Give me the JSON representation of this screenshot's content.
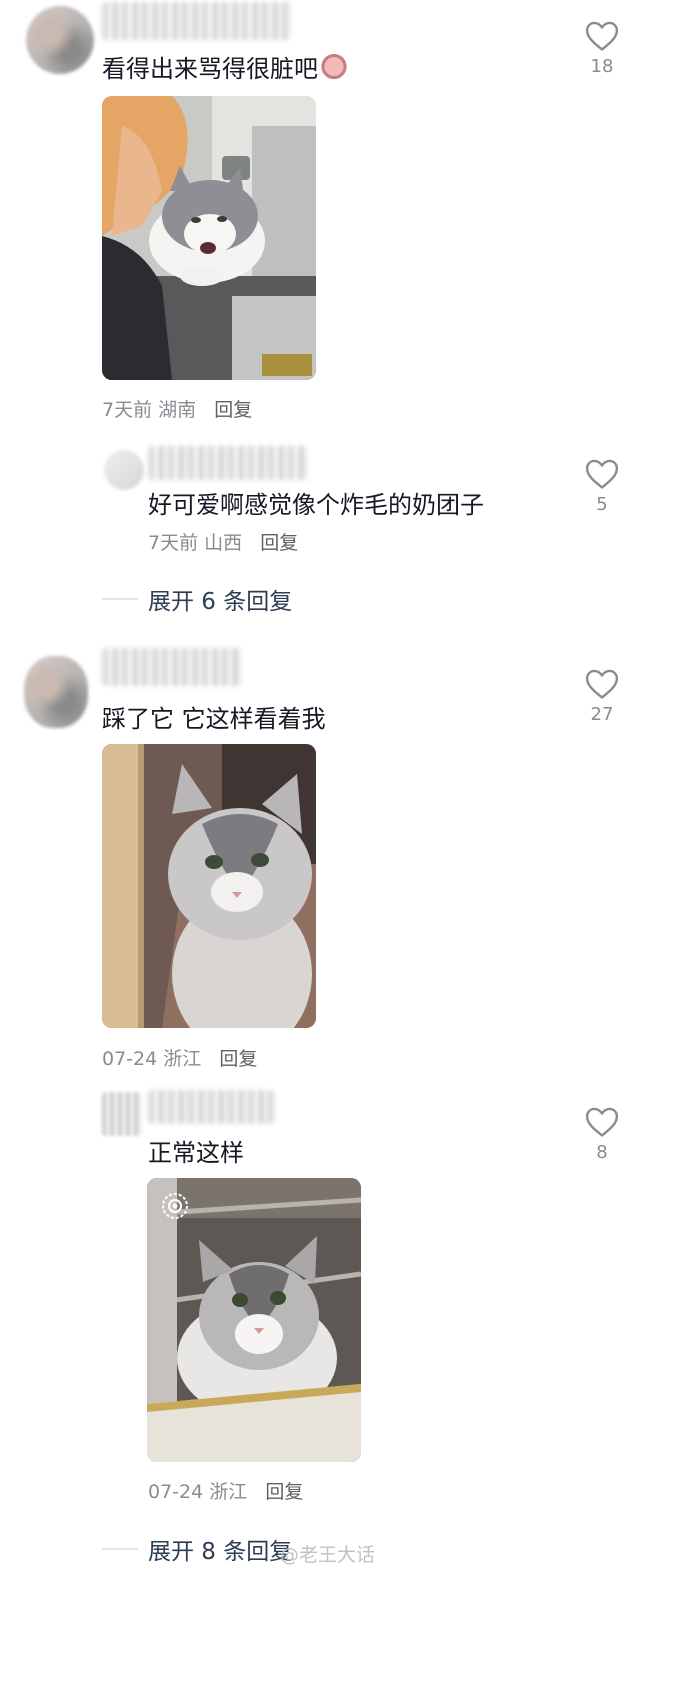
{
  "comments": [
    {
      "text": "看得出来骂得很脏吧",
      "time": "7天前",
      "location": "湖南",
      "reply_label": "回复",
      "likes": "18",
      "reply": {
        "text": "好可爱啊感觉像个炸毛的奶团子",
        "time": "7天前",
        "location": "山西",
        "reply_label": "回复",
        "likes": "5"
      },
      "expand_label": "展开 6 条回复"
    },
    {
      "text": "踩了它 它这样看着我",
      "time": "07-24",
      "location": "浙江",
      "reply_label": "回复",
      "likes": "27",
      "reply": {
        "text": "正常这样",
        "time": "07-24",
        "location": "浙江",
        "reply_label": "回复",
        "likes": "8"
      },
      "expand_label": "展开 8 条回复"
    }
  ],
  "watermark": "@老王大话",
  "icons": {
    "like": "heart-outline-icon",
    "live_photo": "live-photo-icon",
    "emoji": "pig-face-emoji-icon"
  },
  "colors": {
    "text": "#161823",
    "meta": "#8a8b91",
    "expand": "#2d3d52",
    "heart": "#8a8b91"
  }
}
